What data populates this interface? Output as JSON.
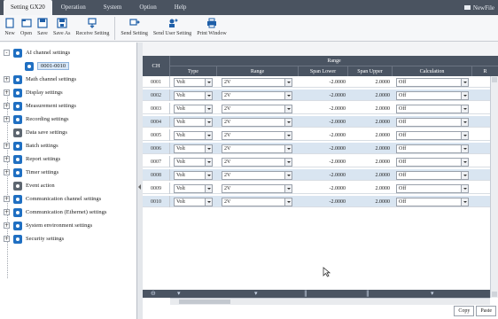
{
  "menu": {
    "active_tab": "Setting GX20",
    "items": [
      "Operation",
      "System",
      "Option",
      "Help"
    ],
    "newfile": "NewFile"
  },
  "toolbar": {
    "buttons": [
      "New",
      "Open",
      "Save",
      "Save As",
      "Receive Setting",
      "Send Setting",
      "Send User Setting",
      "Print Window"
    ]
  },
  "tree": {
    "items": [
      {
        "label": "AI channel settings",
        "expander": "-",
        "dark": false
      },
      {
        "label": "0001-0010",
        "child": true,
        "selected": true
      },
      {
        "label": "Math channel settings",
        "expander": "+",
        "dark": false
      },
      {
        "label": "Display settings",
        "expander": "+",
        "dark": false
      },
      {
        "label": "Measurement settings",
        "expander": "+",
        "dark": false
      },
      {
        "label": "Recording settings",
        "expander": "+",
        "dark": false
      },
      {
        "label": "Data save settings",
        "expander": "",
        "dark": true
      },
      {
        "label": "Batch settings",
        "expander": "+",
        "dark": false
      },
      {
        "label": "Report settings",
        "expander": "+",
        "dark": false
      },
      {
        "label": "Timer settings",
        "expander": "+",
        "dark": false
      },
      {
        "label": "Event action",
        "expander": "",
        "dark": true
      },
      {
        "label": "Communication channel settings",
        "expander": "+",
        "dark": false
      },
      {
        "label": "Communication (Ethernet) settings",
        "expander": "+",
        "dark": false
      },
      {
        "label": "System environment settings",
        "expander": "+",
        "dark": false
      },
      {
        "label": "Security settings",
        "expander": "+",
        "dark": false
      }
    ]
  },
  "grid": {
    "ch_header": "CH",
    "range_group": "Range",
    "columns": [
      "Type",
      "Range",
      "Span Lower",
      "Span Upper",
      "Calculation",
      "R"
    ],
    "rows": [
      {
        "ch": "0001",
        "type": "Volt",
        "range": "2V",
        "span_lower": "-2.0000",
        "span_upper": "2.0000",
        "calc": "Off"
      },
      {
        "ch": "0002",
        "type": "Volt",
        "range": "2V",
        "span_lower": "-2.0000",
        "span_upper": "2.0000",
        "calc": "Off"
      },
      {
        "ch": "0003",
        "type": "Volt",
        "range": "2V",
        "span_lower": "-2.0000",
        "span_upper": "2.0000",
        "calc": "Off"
      },
      {
        "ch": "0004",
        "type": "Volt",
        "range": "2V",
        "span_lower": "-2.0000",
        "span_upper": "2.0000",
        "calc": "Off"
      },
      {
        "ch": "0005",
        "type": "Volt",
        "range": "2V",
        "span_lower": "-2.0000",
        "span_upper": "2.0000",
        "calc": "Off"
      },
      {
        "ch": "0006",
        "type": "Volt",
        "range": "2V",
        "span_lower": "-2.0000",
        "span_upper": "2.0000",
        "calc": "Off"
      },
      {
        "ch": "0007",
        "type": "Volt",
        "range": "2V",
        "span_lower": "-2.0000",
        "span_upper": "2.0000",
        "calc": "Off"
      },
      {
        "ch": "0008",
        "type": "Volt",
        "range": "2V",
        "span_lower": "-2.0000",
        "span_upper": "2.0000",
        "calc": "Off"
      },
      {
        "ch": "0009",
        "type": "Volt",
        "range": "2V",
        "span_lower": "-2.0000",
        "span_upper": "2.0000",
        "calc": "Off"
      },
      {
        "ch": "0010",
        "type": "Volt",
        "range": "2V",
        "span_lower": "-2.0000",
        "span_upper": "2.0000",
        "calc": "Off"
      }
    ]
  },
  "bottom": {
    "copy": "Copy",
    "paste": "Paste"
  },
  "colors": {
    "menubar": "#4a5360",
    "header": "#4a5462",
    "alt_row": "#d9e5f1",
    "icon_blue": "#1f6fc2"
  }
}
